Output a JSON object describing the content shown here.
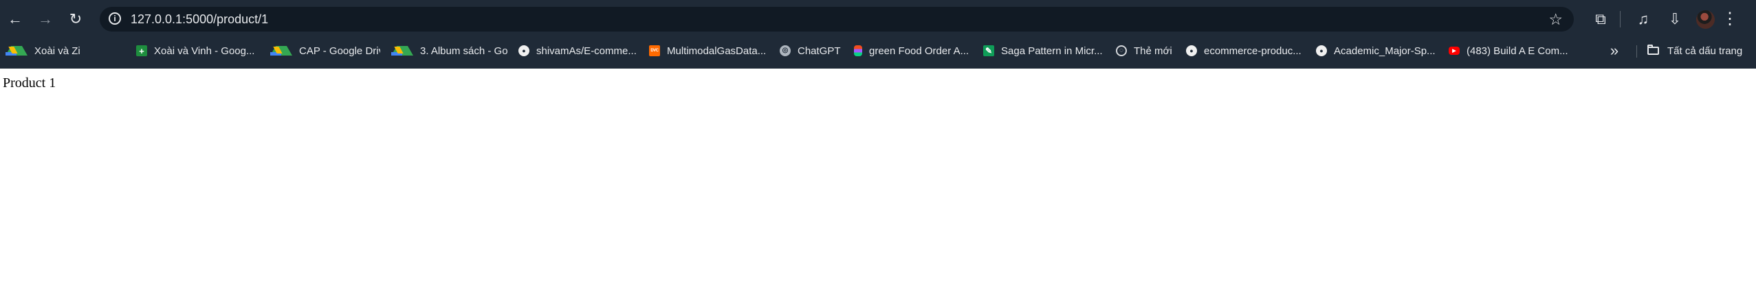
{
  "browser": {
    "url": "127.0.0.1:5000/product/1",
    "nav": {
      "back_icon": "←",
      "forward_icon": "→",
      "reload_icon": "↻"
    },
    "icons": {
      "site_info": "i",
      "bookmark_star": "☆",
      "extensions": "⧉",
      "media": "♫",
      "download": "⇩",
      "menu": "⋮",
      "bookmark_overflow": "»"
    },
    "colors": {
      "chrome_background": "#1f2a37",
      "omnibox_background": "#111a24",
      "text": "#e8eaed",
      "page_background": "#ffffff"
    }
  },
  "bookmarks": [
    {
      "label": "Xoài và Zinh - Goog...",
      "icon": "drive-icon"
    },
    {
      "label": "Xoài và Vinh - Goog...",
      "icon": "sheets-icon"
    },
    {
      "label": "CAP - Google Drive",
      "icon": "drive-icon"
    },
    {
      "label": "3. Album sách - Go...",
      "icon": "drive-icon"
    },
    {
      "label": "shivamAs/E-comme...",
      "icon": "github-icon"
    },
    {
      "label": "MultimodalGasData...",
      "icon": "dvc-icon",
      "icon_text": "DVC"
    },
    {
      "label": "ChatGPT",
      "icon": "chatgpt-icon",
      "icon_text": "◎"
    },
    {
      "label": "green Food Order A...",
      "icon": "figma-icon"
    },
    {
      "label": "Saga Pattern in Micr...",
      "icon": "leaf-icon",
      "icon_text": "✎"
    },
    {
      "label": "Thẻ mới",
      "icon": "globe-icon",
      "icon_text": "◌"
    },
    {
      "label": "ecommerce-produc...",
      "icon": "github-icon"
    },
    {
      "label": "Academic_Major-Sp...",
      "icon": "github-icon"
    },
    {
      "label": "(483) Build A E Com...",
      "icon": "youtube-icon",
      "icon_text": "▶"
    }
  ],
  "all_bookmarks_label": "Tất cả dấu trang",
  "page": {
    "title": "Product 1"
  }
}
